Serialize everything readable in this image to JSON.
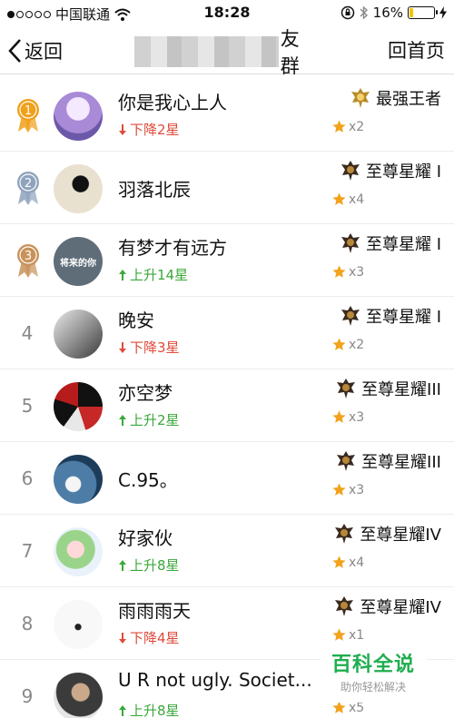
{
  "status_bar": {
    "carrier": "中国联通",
    "time": "18:28",
    "battery": "16%",
    "battery_level": 0.16
  },
  "nav": {
    "back_label": "返回",
    "title_visible": "友群",
    "home_label": "回首页"
  },
  "rows": [
    {
      "rank": "1",
      "name": "你是我心上人",
      "change": "下降2星",
      "direction": "down",
      "tier": "最强王者",
      "stars": "x2",
      "medal": "gold"
    },
    {
      "rank": "2",
      "name": "羽落北辰",
      "change": "",
      "direction": "none",
      "tier": "至尊星耀 I",
      "stars": "x4",
      "medal": "silver"
    },
    {
      "rank": "3",
      "name": "有梦才有远方",
      "change": "上升14星",
      "direction": "up",
      "tier": "至尊星耀 I",
      "stars": "x3",
      "medal": "bronze",
      "avatar_text": "将来的你"
    },
    {
      "rank": "4",
      "name": "晚安",
      "change": "下降3星",
      "direction": "down",
      "tier": "至尊星耀 I",
      "stars": "x2"
    },
    {
      "rank": "5",
      "name": "亦空梦",
      "change": "上升2星",
      "direction": "up",
      "tier": "至尊星耀III",
      "stars": "x3"
    },
    {
      "rank": "6",
      "name": "C.95。",
      "change": "",
      "direction": "none",
      "tier": "至尊星耀III",
      "stars": "x3"
    },
    {
      "rank": "7",
      "name": "好家伙",
      "change": "上升8星",
      "direction": "up",
      "tier": "至尊星耀IV",
      "stars": "x4"
    },
    {
      "rank": "8",
      "name": "雨雨雨天",
      "change": "下降4星",
      "direction": "down",
      "tier": "至尊星耀IV",
      "stars": "x1"
    },
    {
      "rank": "9",
      "name": "U R not ugly. Societ...",
      "change": "上升8星",
      "direction": "up",
      "tier": "",
      "stars": "x5"
    }
  ],
  "watermark": {
    "title": "百科全说",
    "subtitle": "助你轻松解决"
  },
  "colors": {
    "down": "#e04a3a",
    "up": "#3aa83a",
    "star": "#f2a21b",
    "watermark": "#1fae4f",
    "medal_gold": "#f0a01a",
    "medal_silver": "#8fa3bd",
    "medal_bronze": "#c8925a"
  },
  "icons": {
    "back": "chevron-left-icon",
    "wifi": "wifi-icon",
    "lock_rotation": "orientation-lock-icon",
    "bluetooth": "bluetooth-icon",
    "charging": "bolt-icon",
    "tier": "rank-emblem-icon",
    "star": "star-icon",
    "up": "arrow-up-icon",
    "down": "arrow-down-icon",
    "medal": "medal-icon"
  }
}
